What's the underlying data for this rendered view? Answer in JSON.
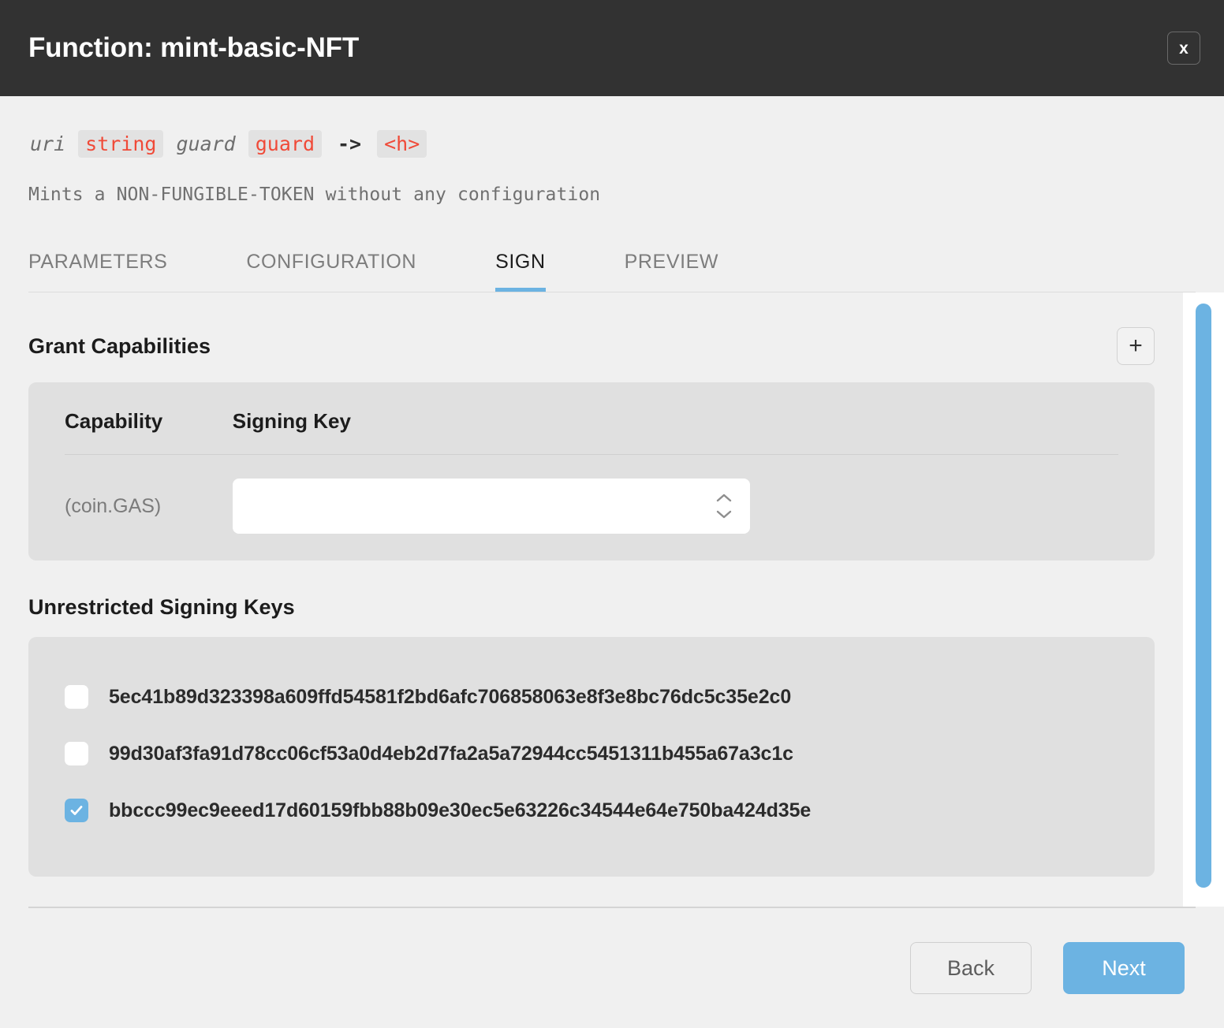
{
  "header": {
    "title": "Function: mint-basic-NFT",
    "close_label": "x"
  },
  "signature": {
    "parts": [
      {
        "kind": "ident",
        "text": "uri"
      },
      {
        "kind": "type",
        "text": "string"
      },
      {
        "kind": "ident",
        "text": "guard"
      },
      {
        "kind": "type",
        "text": "guard"
      },
      {
        "kind": "arrow",
        "text": "->"
      },
      {
        "kind": "type",
        "text": "<h>"
      }
    ],
    "uri_label": "uri",
    "uri_type": "string",
    "guard_label": "guard",
    "guard_type": "guard",
    "arrow": "->",
    "return_type": "<h>"
  },
  "description": "Mints a NON-FUNGIBLE-TOKEN without any configuration",
  "tabs": [
    {
      "label": "PARAMETERS",
      "active": false
    },
    {
      "label": "CONFIGURATION",
      "active": false
    },
    {
      "label": "SIGN",
      "active": true
    },
    {
      "label": "PREVIEW",
      "active": false
    }
  ],
  "grant_capabilities": {
    "title": "Grant Capabilities",
    "add_label": "+",
    "columns": [
      "Capability",
      "Signing Key"
    ],
    "rows": [
      {
        "capability": "(coin.GAS)",
        "signing_key": ""
      }
    ]
  },
  "unrestricted_signing_keys": {
    "title": "Unrestricted Signing Keys",
    "keys": [
      {
        "key": "5ec41b89d323398a609ffd54581f2bd6afc706858063e8f3e8bc76dc5c35e2c0",
        "checked": false
      },
      {
        "key": "99d30af3fa91d78cc06cf53a0d4eb2d7fa2a5a72944cc5451311b455a67a3c1c",
        "checked": false
      },
      {
        "key": "bbccc99ec9eeed17d60159fbb88b09e30ec5e63226c34544e64e750ba424d35e",
        "checked": true
      }
    ]
  },
  "footer": {
    "back_label": "Back",
    "next_label": "Next"
  },
  "colors": {
    "accent": "#6cb3e2",
    "titlebar": "#323232",
    "page_bg": "#f0f0f0",
    "panel_bg": "#e0e0e0",
    "type_text": "#f04a38"
  }
}
